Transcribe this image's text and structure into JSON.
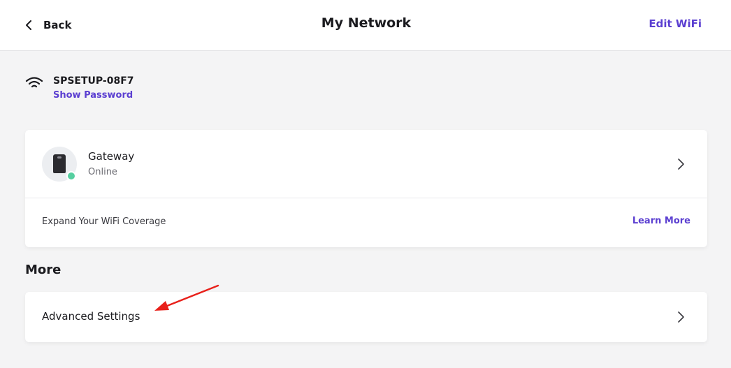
{
  "header": {
    "back_label": "Back",
    "title": "My Network",
    "edit_wifi_label": "Edit WiFi"
  },
  "network": {
    "icon": "wifi-icon",
    "ssid": "SPSETUP-08F7",
    "show_password_label": "Show Password"
  },
  "gateway_card": {
    "device": {
      "icon": "router-icon",
      "name": "Gateway",
      "status": "Online",
      "status_color": "#56cfa0"
    },
    "expand": {
      "label": "Expand Your WiFi Coverage",
      "link_label": "Learn More"
    }
  },
  "more_section": {
    "title": "More",
    "items": [
      {
        "label": "Advanced Settings",
        "icon": "chevron-right-icon"
      }
    ]
  },
  "annotation": {
    "type": "arrow",
    "color": "#e8201a",
    "points_to": "Advanced Settings"
  },
  "colors": {
    "accent": "#5b3fd1",
    "background": "#f4f4f5",
    "card": "#ffffff",
    "online": "#56cfa0"
  }
}
